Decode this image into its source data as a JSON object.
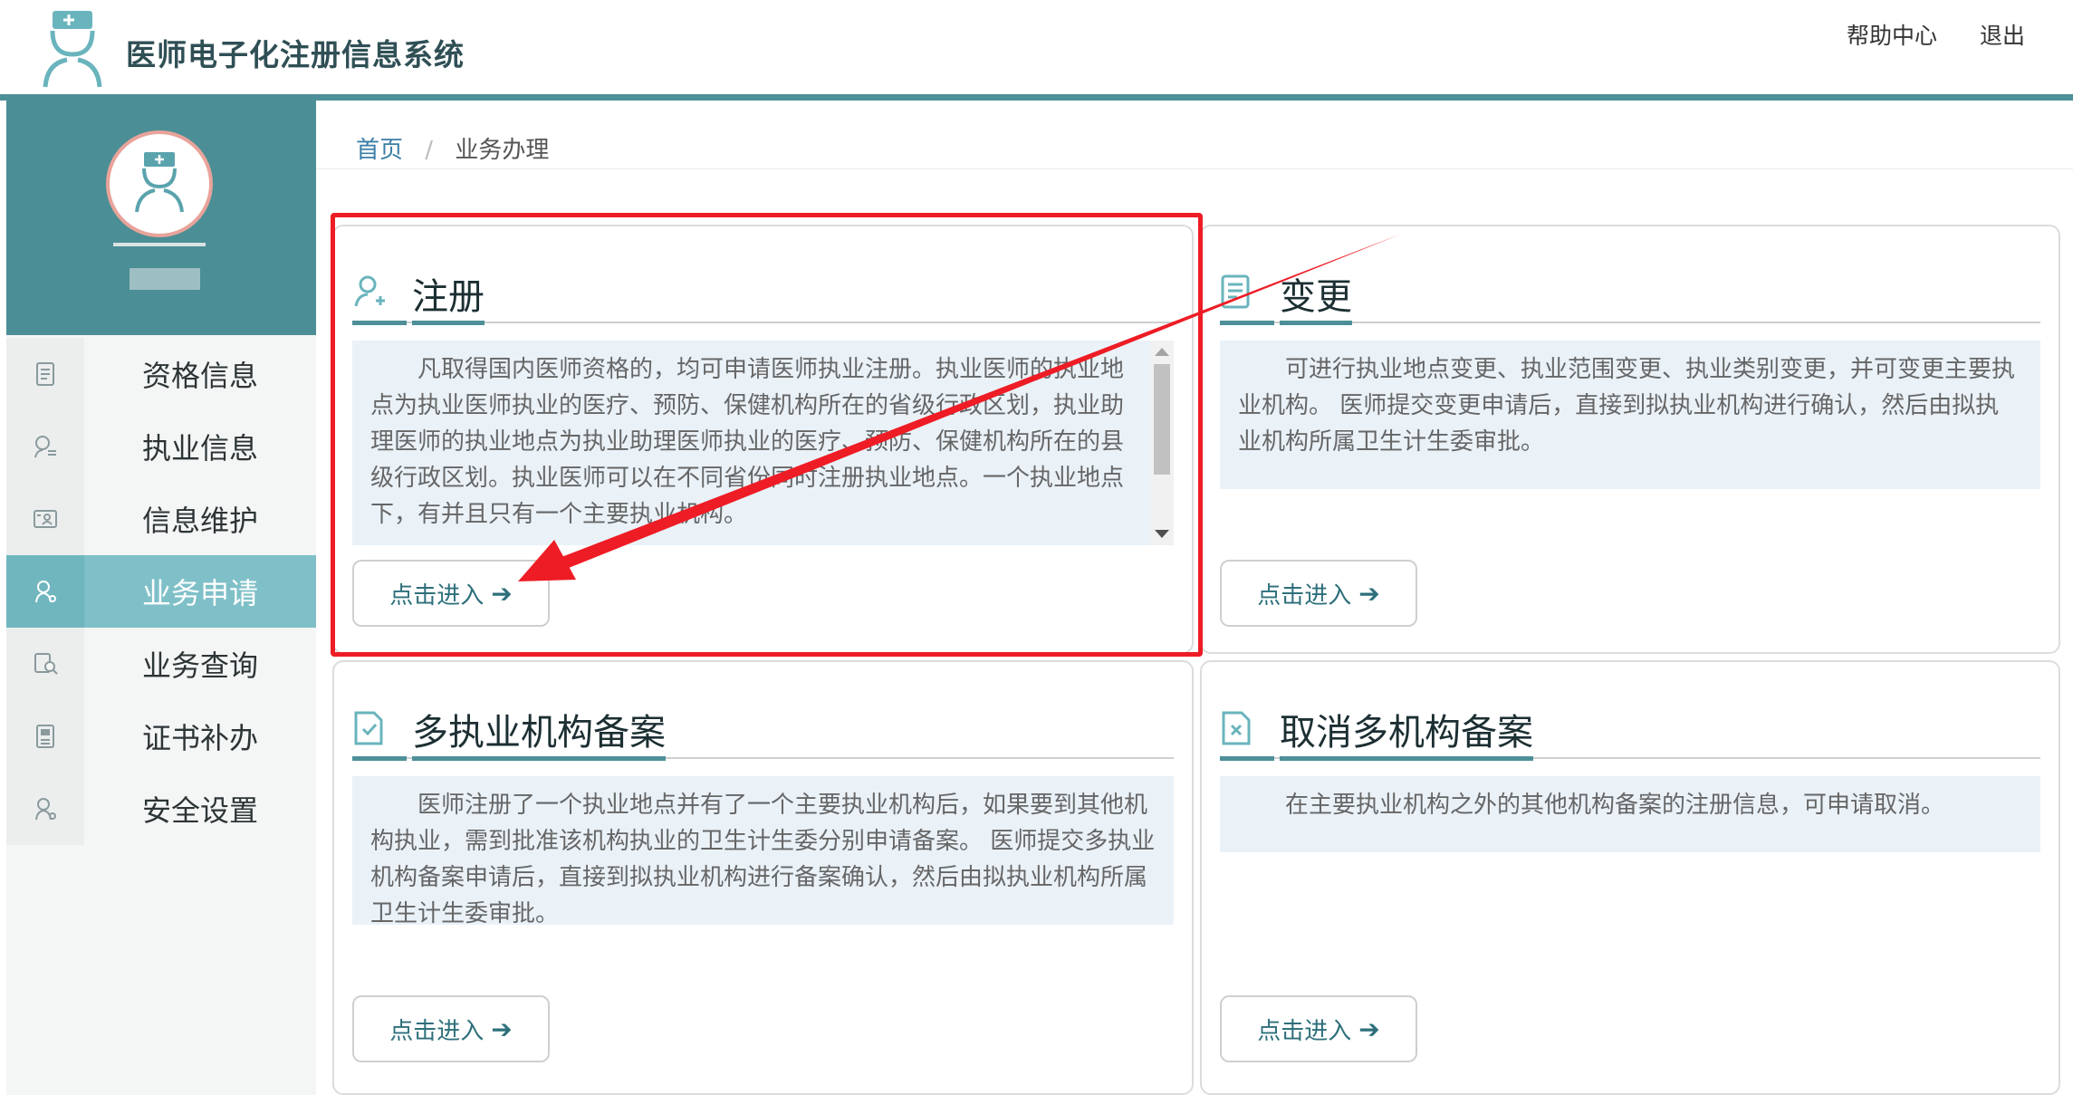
{
  "header": {
    "title": "医师电子化注册信息系统",
    "help_label": "帮助中心",
    "logout_label": "退出"
  },
  "sidebar": {
    "items": [
      {
        "label": "资格信息",
        "icon": "document-icon",
        "active": false
      },
      {
        "label": "执业信息",
        "icon": "doctor-list-icon",
        "active": false
      },
      {
        "label": "信息维护",
        "icon": "id-card-icon",
        "active": false
      },
      {
        "label": "业务申请",
        "icon": "user-apply-icon",
        "active": true
      },
      {
        "label": "业务查询",
        "icon": "user-search-icon",
        "active": false
      },
      {
        "label": "证书补办",
        "icon": "certificate-icon",
        "active": false
      },
      {
        "label": "安全设置",
        "icon": "user-security-icon",
        "active": false
      }
    ]
  },
  "breadcrumb": {
    "home": "首页",
    "separator": "/",
    "current": "业务办理"
  },
  "cards": [
    {
      "title": "注册",
      "icon": "user-add-icon",
      "description": "凡取得国内医师资格的，均可申请医师执业注册。执业医师的执业地点为执业医师执业的医疗、预防、保健机构所在的省级行政区划，执业助理医师的执业地点为执业助理医师执业的医疗、预防、保健机构所在的县级行政区划。执业医师可以在不同省份同时注册执业地点。一个执业地点下，有并且只有一个主要执业机构。",
      "button": "点击进入"
    },
    {
      "title": "变更",
      "icon": "edit-document-icon",
      "description": "可进行执业地点变更、执业范围变更、执业类别变更，并可变更主要执业机构。 医师提交变更申请后，直接到拟执业机构进行确认，然后由拟执业机构所属卫生计生委审批。",
      "button": "点击进入"
    },
    {
      "title": "多执业机构备案",
      "icon": "file-check-icon",
      "description": "医师注册了一个执业地点并有了一个主要执业机构后，如果要到其他机构执业，需到批准该机构执业的卫生计生委分别申请备案。 医师提交多执业机构备案申请后，直接到拟执业机构进行备案确认，然后由拟执业机构所属卫生计生委审批。",
      "button": "点击进入"
    },
    {
      "title": "取消多机构备案",
      "icon": "file-cancel-icon",
      "description": "在主要执业机构之外的其他机构备案的注册信息，可申请取消。",
      "button": "点击进入"
    }
  ],
  "colors": {
    "accent": "#4d8f98",
    "sidebar_active": "#7fc0c8",
    "annotation_red": "#ee1c25"
  }
}
